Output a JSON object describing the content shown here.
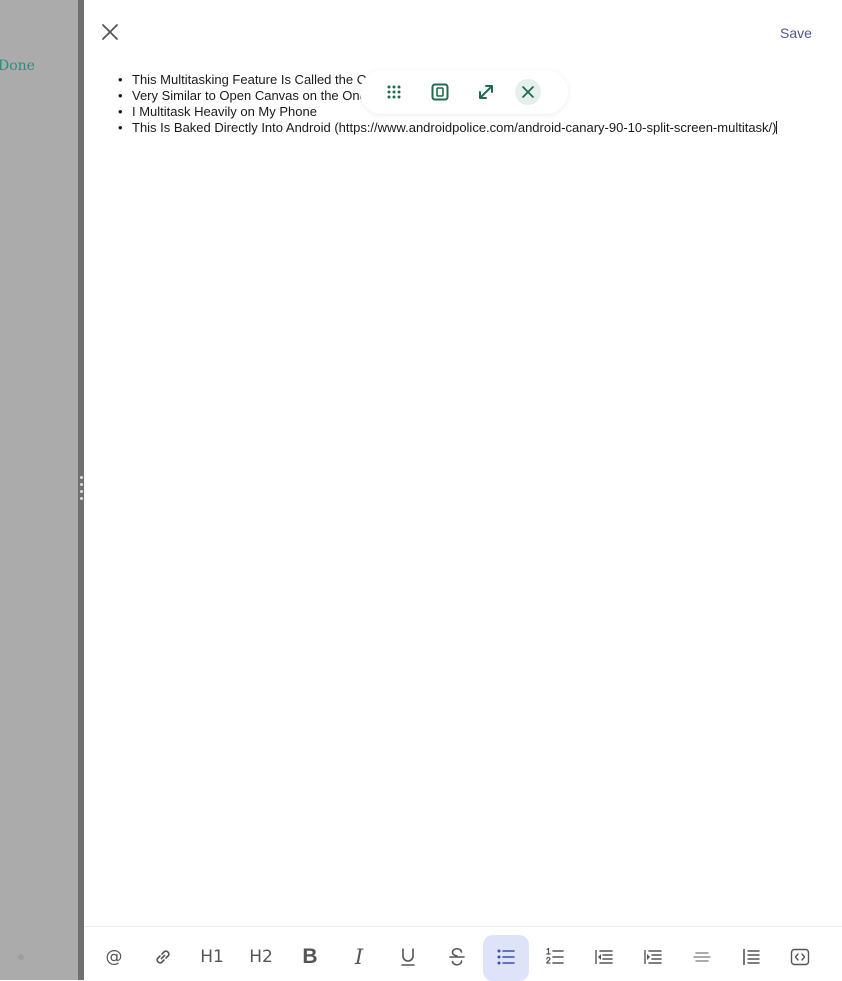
{
  "left_pane": {
    "done_label": "Done"
  },
  "header": {
    "close_icon": "close-icon",
    "save_label": "Save"
  },
  "editor": {
    "bullets": [
      "This Multitasking Feature Is Called the Open Canvas",
      "Very Similar to Open Canvas on the OnePlus Open",
      "I Multitask Heavily on My Phone",
      "This Is Baked Directly Into Android (https://www.androidpolice.com/android-canary-90-10-split-screen-multitask/)"
    ]
  },
  "floating_toolbar": {
    "icons": [
      "drag-handle-icon",
      "window-icon",
      "expand-icon",
      "close-icon"
    ],
    "accent_color": "#1f6b4f"
  },
  "bottom_toolbar": {
    "items": [
      {
        "name": "mention-icon",
        "label": "@"
      },
      {
        "name": "link-icon",
        "label": ""
      },
      {
        "name": "heading-1-button",
        "label": "H1"
      },
      {
        "name": "heading-2-button",
        "label": "H2"
      },
      {
        "name": "bold-button",
        "label": "B"
      },
      {
        "name": "italic-button",
        "label": "I"
      },
      {
        "name": "underline-icon",
        "label": ""
      },
      {
        "name": "strikethrough-icon",
        "label": ""
      },
      {
        "name": "bulleted-list-icon",
        "label": "",
        "active": true
      },
      {
        "name": "numbered-list-icon",
        "label": ""
      },
      {
        "name": "outdent-icon",
        "label": ""
      },
      {
        "name": "indent-icon",
        "label": ""
      },
      {
        "name": "horizontal-rule-icon",
        "label": ""
      },
      {
        "name": "blockquote-icon",
        "label": ""
      },
      {
        "name": "code-block-icon",
        "label": ""
      }
    ],
    "active_bg_color": "#dfe3fa"
  }
}
